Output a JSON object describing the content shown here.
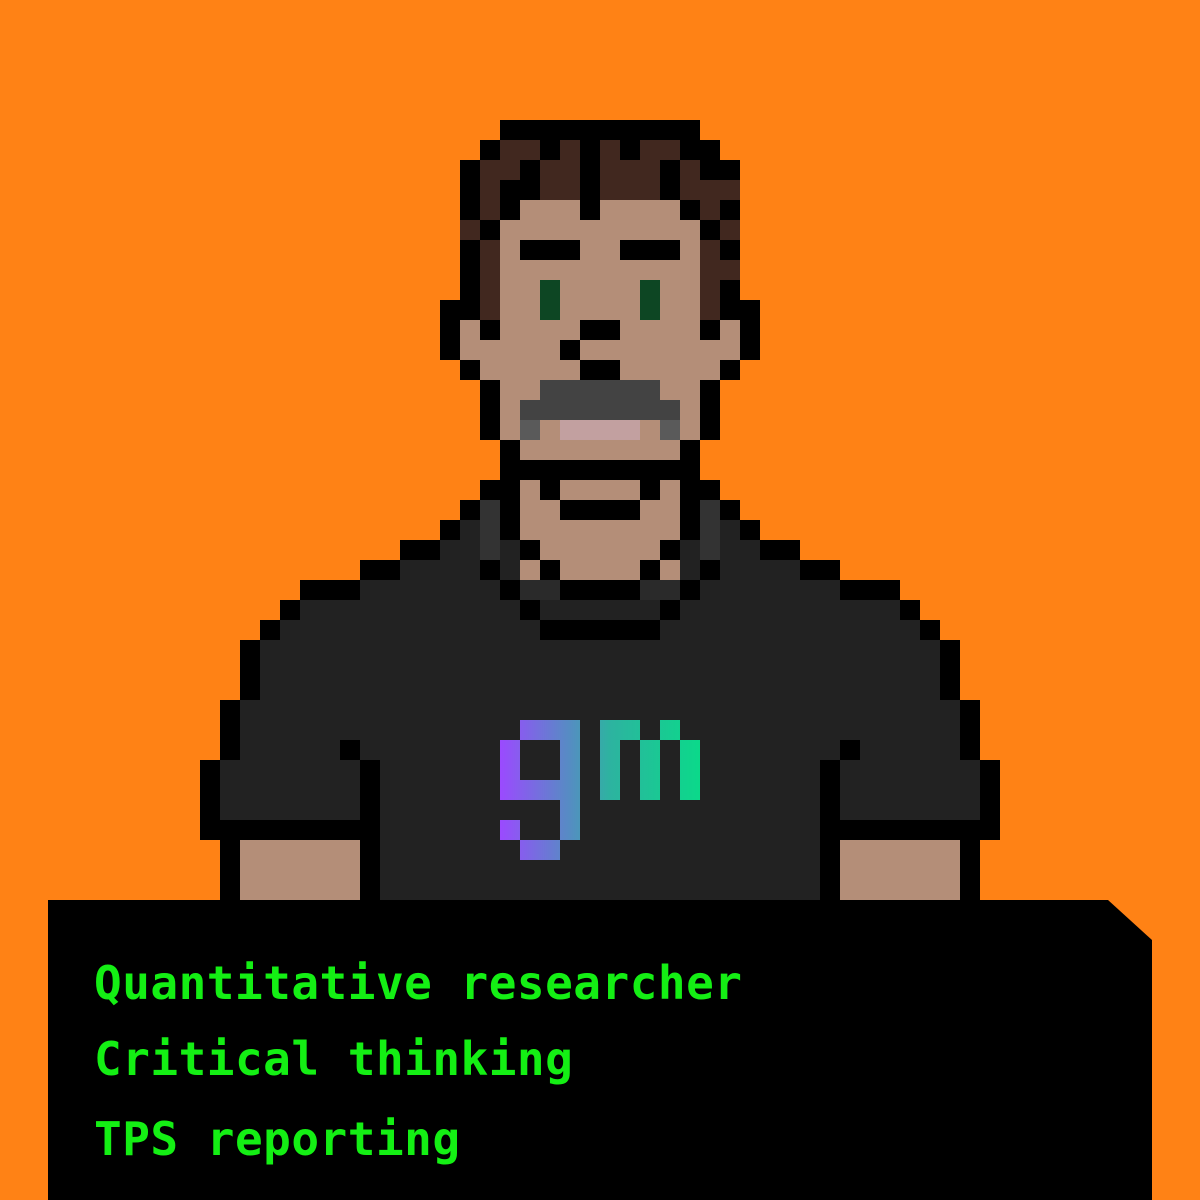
{
  "background_color": "#FF8215",
  "avatar": {
    "shirt_logo_text": "gm",
    "colors": {
      "outline": "#000000",
      "skin": "#B48E78",
      "hair": "#41281F",
      "eyes": "#0D4623",
      "mustache": "#434343",
      "mustache_edge": "#5A5A5A",
      "lips": "#C2A0A0",
      "shirt": "#222222",
      "logo_gradient": [
        "#9B4AFF",
        "#2DB3A0",
        "#0BD98A"
      ]
    }
  },
  "info_panel": {
    "text_color": "#14EF14",
    "traits": [
      "Quantitative researcher",
      "Critical thinking",
      "TPS reporting"
    ]
  }
}
